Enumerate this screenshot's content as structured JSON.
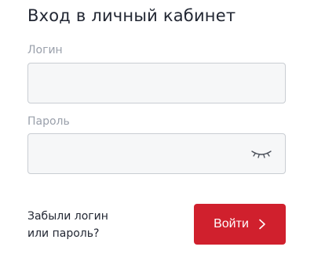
{
  "form": {
    "title": "Вход в личный кабинет",
    "login": {
      "label": "Логин",
      "value": "",
      "placeholder": ""
    },
    "password": {
      "label": "Пароль",
      "value": "",
      "placeholder": "",
      "toggle_icon": "closed-eye-icon"
    },
    "forgot_link": {
      "line1": "Забыли логин",
      "line2": "или пароль?"
    },
    "submit": {
      "label": "Войти",
      "icon": "chevron-right-icon"
    }
  },
  "colors": {
    "accent": "#d0202d",
    "text": "#222733",
    "label": "#9aa0ab",
    "field_border": "#c9cdd3",
    "field_bg": "#f6f7f8"
  }
}
